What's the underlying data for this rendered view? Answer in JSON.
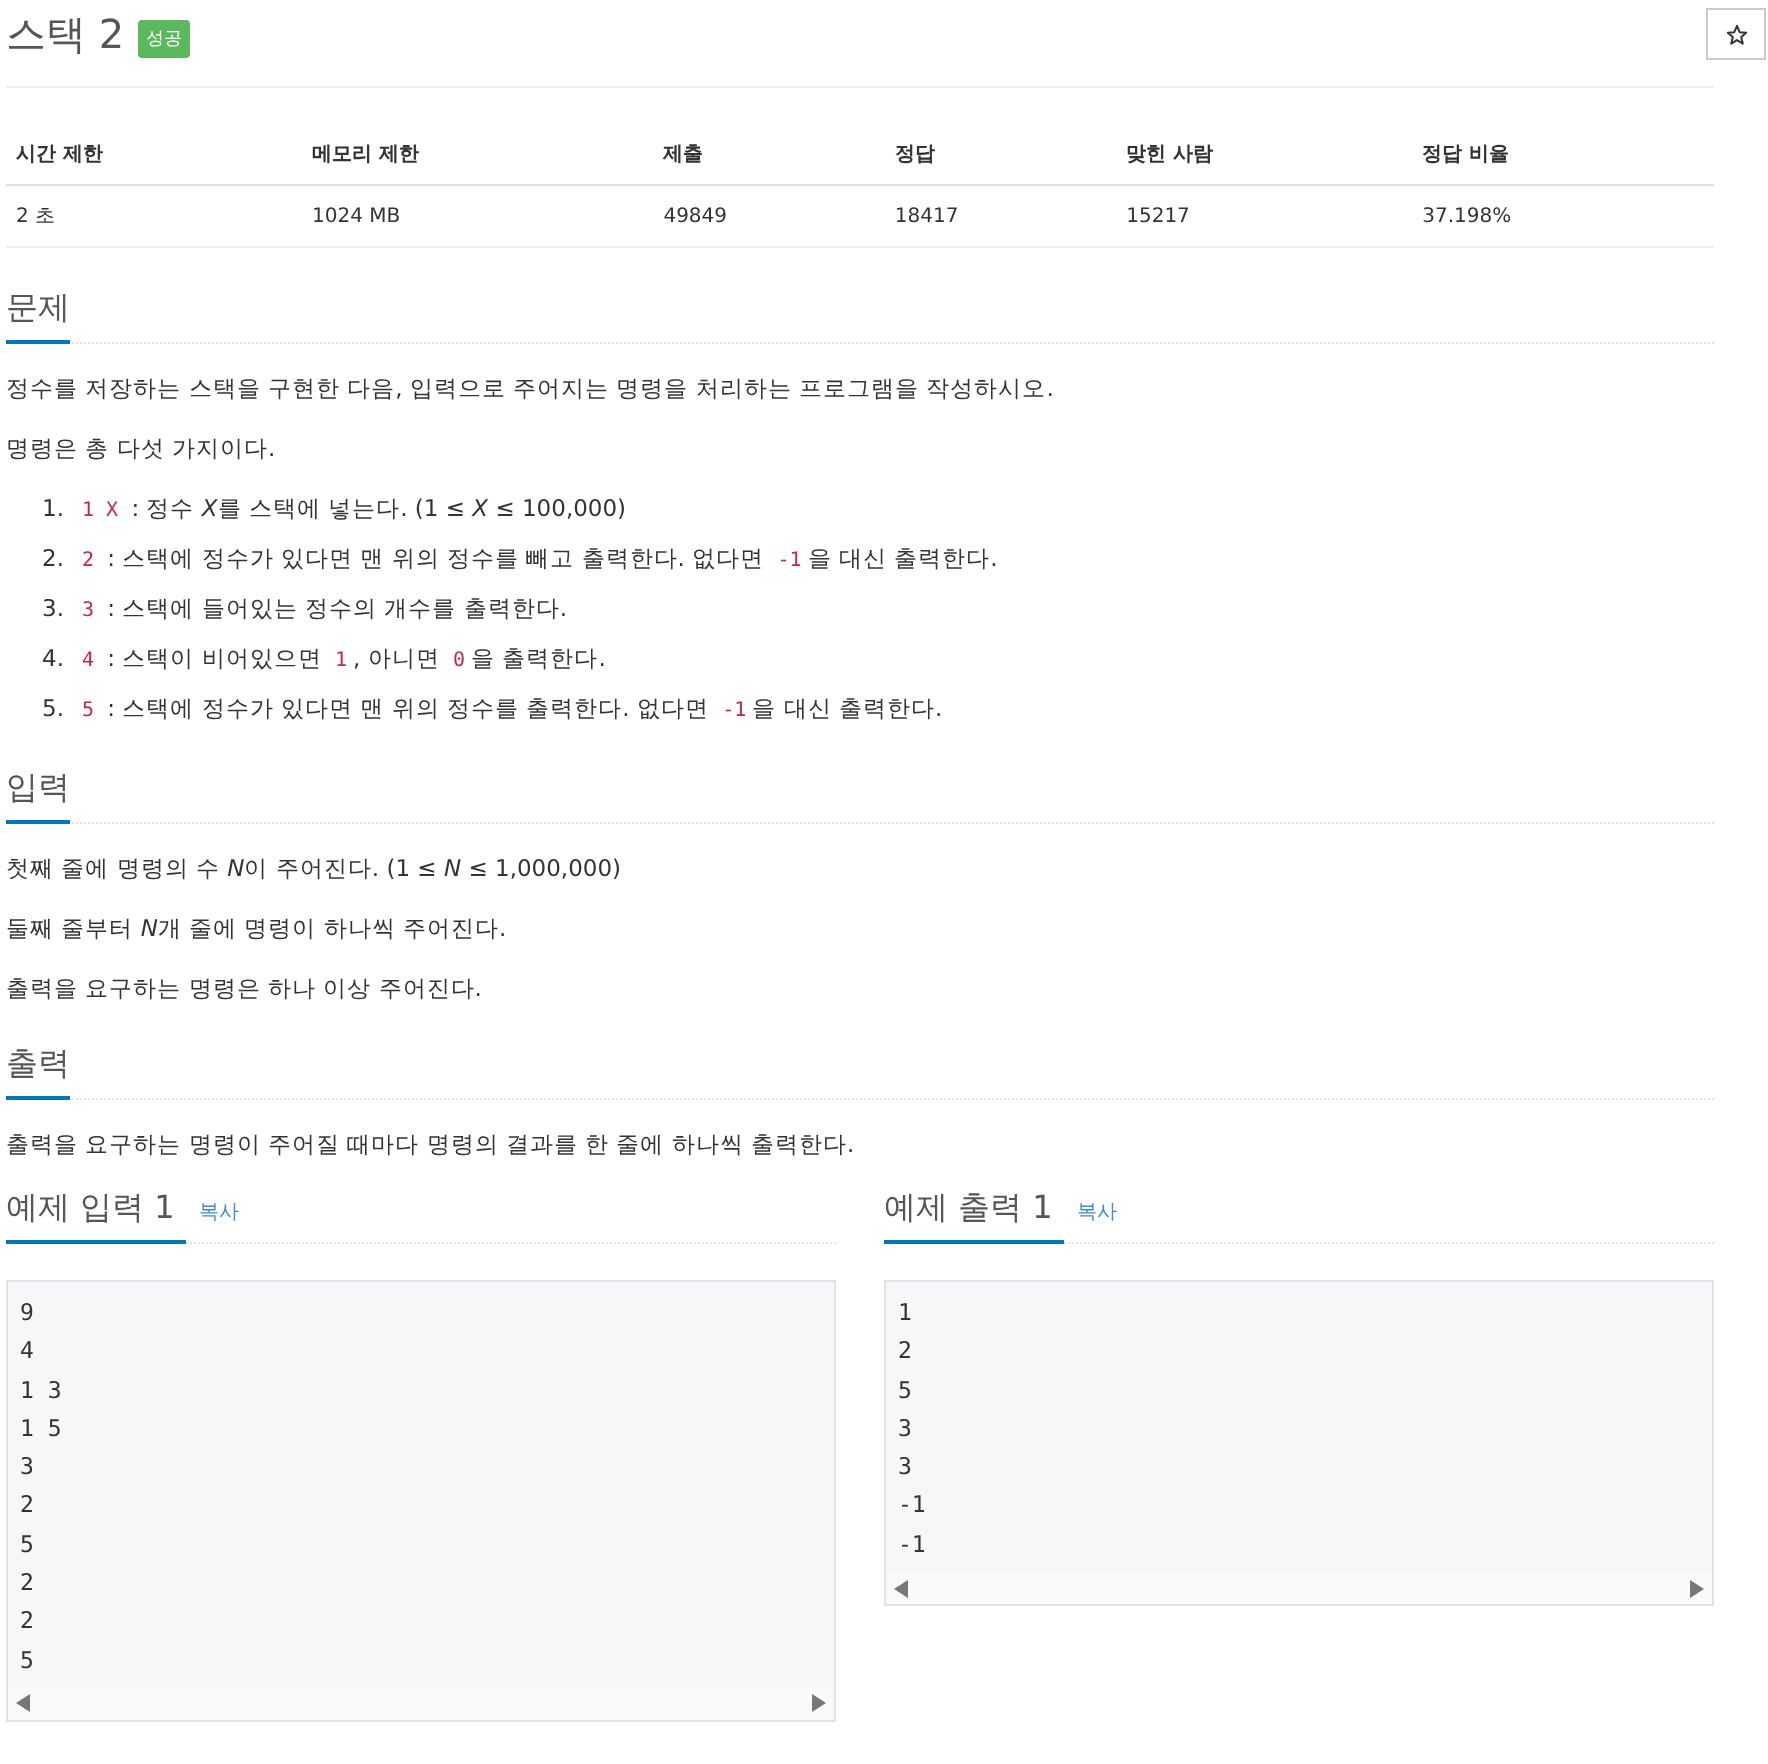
{
  "title": "스택 2",
  "badge": "성공",
  "stats": {
    "columns": [
      "시간 제한",
      "메모리 제한",
      "제출",
      "정답",
      "맞힌 사람",
      "정답 비율"
    ],
    "rows": [
      [
        "2 초",
        "1024 MB",
        "49849",
        "18417",
        "15217",
        "37.198%"
      ]
    ]
  },
  "sections": [
    {
      "heading": "문제",
      "paragraphs": [
        "정수를 저장하는 스택을 구현한 다음, 입력으로 주어지는 명령을 처리하는 프로그램을 작성하시오.",
        "명령은 총 다섯 가지이다."
      ],
      "list": [
        {
          "number": "1.",
          "segments": [
            {
              "kind": "code",
              "text": "1 X"
            },
            {
              "kind": "text",
              "text": " : 정수 "
            },
            {
              "kind": "italic",
              "text": "X"
            },
            {
              "kind": "text",
              "text": "를 스택에 넣는다. (1 ≤ "
            },
            {
              "kind": "italic",
              "text": "X"
            },
            {
              "kind": "text",
              "text": " ≤ 100,000)"
            }
          ]
        },
        {
          "number": "2.",
          "segments": [
            {
              "kind": "code",
              "text": "2"
            },
            {
              "kind": "text",
              "text": " : 스택에 정수가 있다면 맨 위의 정수를 빼고 출력한다. 없다면 "
            },
            {
              "kind": "code",
              "text": "-1"
            },
            {
              "kind": "text",
              "text": "을 대신 출력한다."
            }
          ]
        },
        {
          "number": "3.",
          "segments": [
            {
              "kind": "code",
              "text": "3"
            },
            {
              "kind": "text",
              "text": " : 스택에 들어있는 정수의 개수를 출력한다."
            }
          ]
        },
        {
          "number": "4.",
          "segments": [
            {
              "kind": "code",
              "text": "4"
            },
            {
              "kind": "text",
              "text": " : 스택이 비어있으면 "
            },
            {
              "kind": "code",
              "text": "1"
            },
            {
              "kind": "text",
              "text": ", 아니면 "
            },
            {
              "kind": "code",
              "text": "0"
            },
            {
              "kind": "text",
              "text": "을 출력한다."
            }
          ]
        },
        {
          "number": "5.",
          "segments": [
            {
              "kind": "code",
              "text": "5"
            },
            {
              "kind": "text",
              "text": " : 스택에 정수가 있다면 맨 위의 정수를 출력한다. 없다면 "
            },
            {
              "kind": "code",
              "text": "-1"
            },
            {
              "kind": "text",
              "text": "을 대신 출력한다."
            }
          ]
        }
      ]
    },
    {
      "heading": "입력",
      "rich_paragraphs": [
        [
          {
            "kind": "text",
            "text": "첫째 줄에 명령의 수 "
          },
          {
            "kind": "italic",
            "text": "N"
          },
          {
            "kind": "text",
            "text": "이 주어진다. (1 ≤ "
          },
          {
            "kind": "italic",
            "text": "N"
          },
          {
            "kind": "text",
            "text": " ≤ 1,000,000)"
          }
        ],
        [
          {
            "kind": "text",
            "text": "둘째 줄부터 "
          },
          {
            "kind": "italic",
            "text": "N"
          },
          {
            "kind": "text",
            "text": "개 줄에 명령이 하나씩 주어진다."
          }
        ],
        [
          {
            "kind": "text",
            "text": "출력을 요구하는 명령은 하나 이상 주어진다."
          }
        ]
      ]
    },
    {
      "heading": "출력",
      "paragraphs": [
        "출력을 요구하는 명령이 주어질 때마다 명령의 결과를 한 줄에 하나씩 출력한다."
      ]
    }
  ],
  "samples": [
    {
      "heading": "예제 입력 1",
      "copy": "복사",
      "lines": [
        "9",
        "4",
        "1 3",
        "1 5",
        "3",
        "2",
        "5",
        "2",
        "2",
        "5"
      ]
    },
    {
      "heading": "예제 출력 1",
      "copy": "복사",
      "lines": [
        "1",
        "2",
        "5",
        "3",
        "3",
        "-1",
        "-1"
      ]
    }
  ]
}
